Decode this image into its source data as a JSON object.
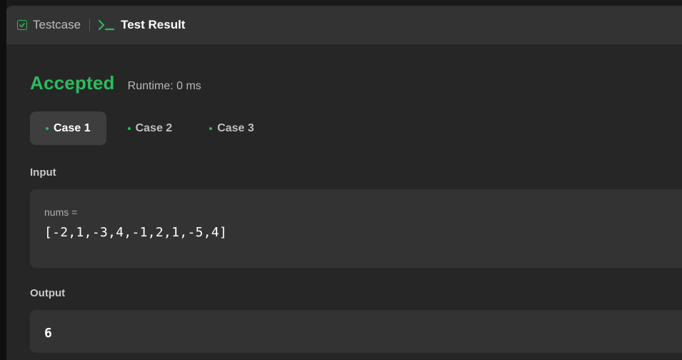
{
  "tabs": {
    "testcase_label": "Testcase",
    "result_label": "Test Result"
  },
  "result": {
    "status": "Accepted",
    "runtime": "Runtime: 0 ms"
  },
  "cases": [
    {
      "label": "Case 1",
      "active": true
    },
    {
      "label": "Case 2",
      "active": false
    },
    {
      "label": "Case 3",
      "active": false
    }
  ],
  "input": {
    "section_label": "Input",
    "param_name": "nums =",
    "param_value": "[-2,1,-3,4,-1,2,1,-5,4]"
  },
  "output": {
    "section_label": "Output",
    "value": "6"
  },
  "colors": {
    "accent_green": "#2cbb5d",
    "panel_bg": "#262626",
    "tabbar_bg": "#333333"
  },
  "icons": {
    "testcase_icon": "checkbox-icon",
    "result_icon": "terminal-icon"
  }
}
